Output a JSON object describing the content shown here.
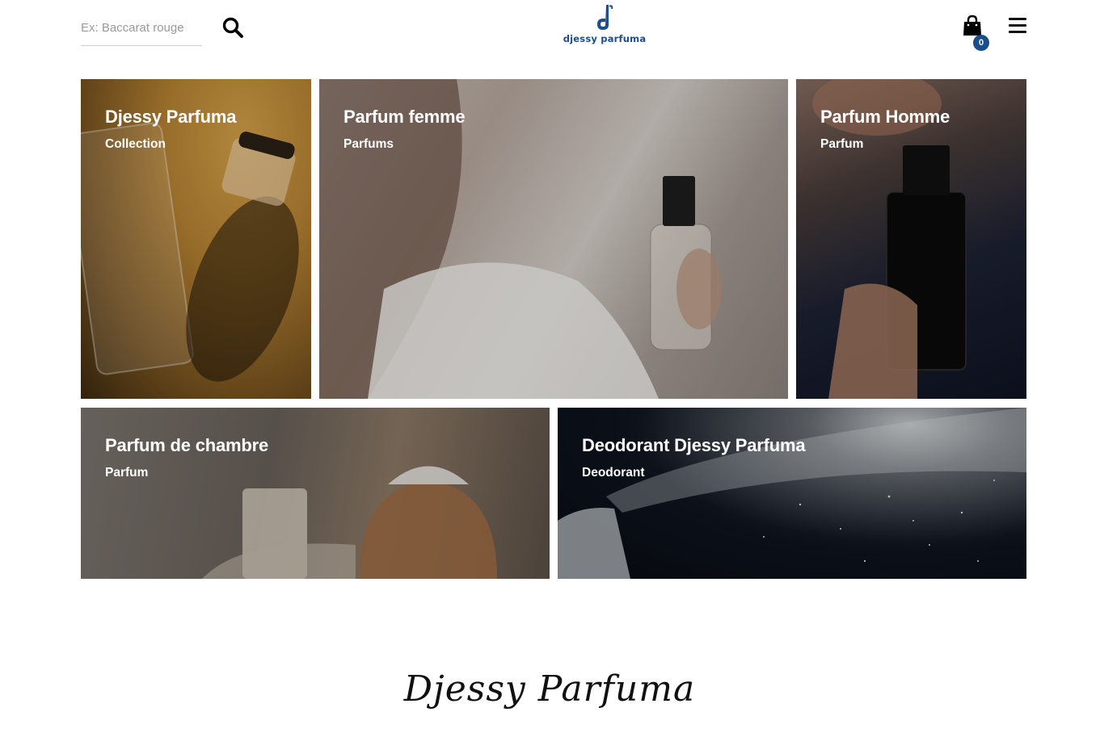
{
  "header": {
    "search": {
      "placeholder": "Ex: Baccarat rouge",
      "value": ""
    },
    "logo_text": "djessy parfuma",
    "cart_count": "0",
    "colors": {
      "brand": "#1e4e8c",
      "badge": "#1a4d8c"
    }
  },
  "tiles": [
    {
      "title": "Djessy Parfuma",
      "subtitle": "Collection"
    },
    {
      "title": "Parfum femme",
      "subtitle": "Parfums"
    },
    {
      "title": "Parfum Homme",
      "subtitle": "Parfum"
    },
    {
      "title": "Parfum de chambre",
      "subtitle": "Parfum"
    },
    {
      "title": "Deodorant Djessy Parfuma",
      "subtitle": "Deodorant"
    }
  ],
  "signature_text": "Djessy Parfuma",
  "icons": [
    "search-icon",
    "logo-icon",
    "shopping-bag-icon",
    "hamburger-menu-icon"
  ]
}
